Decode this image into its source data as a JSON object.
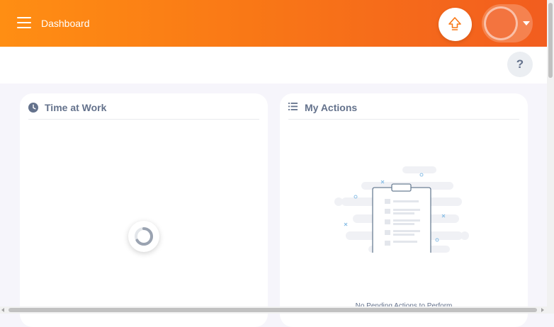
{
  "header": {
    "title": "Dashboard",
    "menu_icon": "hamburger-menu-icon",
    "upgrade_icon": "upgrade-arrow-icon",
    "profile_caret_icon": "caret-down-icon"
  },
  "subheader": {
    "help_label": "?"
  },
  "cards": {
    "time_at_work": {
      "title": "Time at Work",
      "icon": "clock-icon",
      "loading": true
    },
    "my_actions": {
      "title": "My Actions",
      "icon": "list-icon",
      "empty_message": "No Pending Actions to Perform"
    }
  },
  "colors": {
    "brand_start": "#ff8e13",
    "brand_end": "#f25d1f",
    "text_muted": "#64728c",
    "background": "#f6f5fb"
  }
}
